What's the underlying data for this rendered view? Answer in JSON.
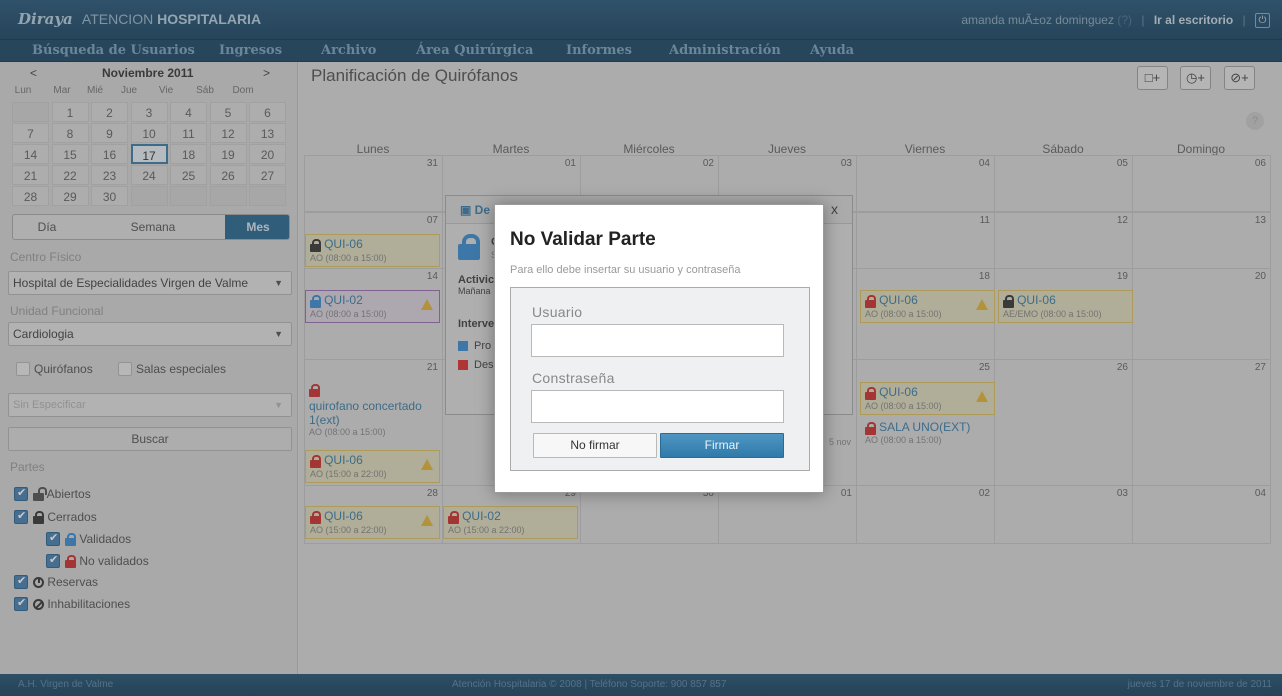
{
  "header": {
    "logo": "Diraya",
    "module_prefix": "ATENCION",
    "module_name": "HOSPITALARIA",
    "user_name": "amanda muÃ±oz dominguez",
    "help_marker": "(?)",
    "sep1": "|",
    "desktop_link": "Ir al escritorio",
    "sep2": "|",
    "power_icon": "power-icon"
  },
  "nav": [
    "Búsqueda de Usuarios",
    "Ingresos",
    "Archivo",
    "Área Quirúrgica",
    "Informes",
    "Administración",
    "Ayuda"
  ],
  "mini_calendar": {
    "prev": "<",
    "next": ">",
    "month": "Noviembre 2011",
    "dow": [
      "Lun",
      "Mar",
      "Mié",
      "Jue",
      "Vie",
      "Sáb",
      "Dom"
    ],
    "weeks": [
      [
        "",
        "1",
        "2",
        "3",
        "4",
        "5",
        "6"
      ],
      [
        "7",
        "8",
        "9",
        "10",
        "11",
        "12",
        "13"
      ],
      [
        "14",
        "15",
        "16",
        "17",
        "18",
        "19",
        "20"
      ],
      [
        "21",
        "22",
        "23",
        "24",
        "25",
        "26",
        "27"
      ],
      [
        "28",
        "29",
        "30",
        "",
        "",
        "",
        ""
      ]
    ],
    "today": "17"
  },
  "view_toggle": {
    "day": "Día",
    "week": "Semana",
    "month": "Mes",
    "active": "Mes"
  },
  "filters": {
    "centro_label": "Centro Físico",
    "centro_value": "Hospital de Especialidades Virgen de Valme",
    "unidad_label": "Unidad Funcional",
    "unidad_value": "Cardiologia",
    "quirofanos": "Quirófanos",
    "salas": "Salas especiales",
    "sin_especificar": "Sin Especificar",
    "buscar": "Buscar",
    "partes_label": "Partes",
    "abiertos": "Abiertos",
    "cerrados": "Cerrados",
    "validados": "Validados",
    "no_validados": "No validados",
    "reservas": "Reservas",
    "inhabilitaciones": "Inhabilitaciones"
  },
  "main": {
    "title": "Planificación de Quirófanos",
    "toolbar": [
      {
        "icon": "calendar-add-icon",
        "label": "□+"
      },
      {
        "icon": "clock-add-icon",
        "label": "◷+"
      },
      {
        "icon": "ban-add-icon",
        "label": "⊘+"
      }
    ],
    "help": "?",
    "weekdays": [
      "Lunes",
      "Martes",
      "Miércoles",
      "Jueves",
      "Viernes",
      "Sábado",
      "Domingo"
    ],
    "weeks": [
      [
        "31",
        "01",
        "02",
        "03",
        "04",
        "05",
        "06"
      ],
      [
        "07",
        "",
        "",
        "10",
        "11",
        "12",
        "13"
      ],
      [
        "14",
        "",
        "",
        "17",
        "18",
        "19",
        "20"
      ],
      [
        "21",
        "",
        "",
        "24",
        "25",
        "26",
        "27"
      ],
      [
        "28",
        "29",
        "30",
        "01",
        "02",
        "03",
        "04"
      ]
    ],
    "events": [
      {
        "id": "e1",
        "lock": "black",
        "title": "QUI-06",
        "time": "AO (08:00 a 15:00)",
        "warn": false
      },
      {
        "id": "e2",
        "lock": "blue",
        "title": "QUI-02",
        "time": "AO (08:00 a 15:00)",
        "warn": true
      },
      {
        "id": "e3",
        "lock": "red",
        "title": "QUI-06",
        "time": "AO (08:00 a 15:00)",
        "warn": true
      },
      {
        "id": "e4",
        "lock": "black",
        "title": "QUI-06",
        "time": "AE/EMO (08:00 a 15:00)",
        "warn": false
      },
      {
        "id": "e5",
        "lock": "red",
        "title": "quirofano concertado 1(ext)",
        "time": "AO (08:00 a 15:00)",
        "warn": false
      },
      {
        "id": "e6",
        "lock": "red",
        "title": "QUI-06",
        "time": "AO (15:00 a 22:00)",
        "warn": true
      },
      {
        "id": "e7",
        "lock": "red",
        "title": "QUI-06",
        "time": "AO (08:00 a 15:00)",
        "warn": true
      },
      {
        "id": "e8",
        "lock": "red",
        "title": "SALA UNO(EXT)",
        "time": "AO (08:00 a 15:00)",
        "warn": false
      },
      {
        "id": "e9",
        "lock": "red",
        "title": "QUI-06",
        "time": "AO (15:00 a 22:00)",
        "warn": true
      },
      {
        "id": "e10",
        "lock": "red",
        "title": "QUI-02",
        "time": "AO (15:00 a 22:00)",
        "warn": false
      }
    ],
    "partial_date": "5 nov"
  },
  "popover": {
    "title": "De",
    "close": "x",
    "line1": "C",
    "line2": "S",
    "actividad": "Activic",
    "manana": "Mañana",
    "interv": "Interve",
    "pro": "Pro",
    "des": "Des",
    "colors": {
      "pro": "#3d8ed0",
      "des": "#d33"
    }
  },
  "modal": {
    "title": "No Validar Parte",
    "subtitle": "Para ello debe insertar su usuario y contraseña",
    "user_label": "Usuario",
    "user_value": "",
    "password_label": "Constraseña",
    "password_value": "",
    "no_firmar": "No firmar",
    "firmar": "Firmar",
    "accent": "#2f7aaa"
  },
  "footer": {
    "left": "A.H. Virgen de Valme",
    "center": "Atención Hospitalaria © 2008 | Teléfono Soporte: 900 857 857",
    "right": "jueves 17 de noviembre de 2011"
  }
}
